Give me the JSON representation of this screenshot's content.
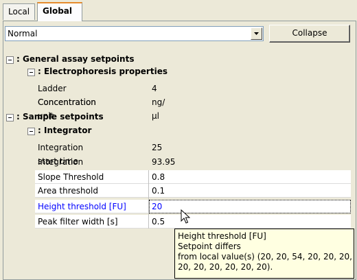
{
  "tabs": [
    {
      "label": "Local"
    },
    {
      "label": "Global"
    }
  ],
  "combo": {
    "value": "Normal"
  },
  "collapse_label": "Collapse",
  "tree": {
    "general": "General assay setpoints",
    "electrophoresis": "Electrophoresis properties",
    "sample": "Sample setpoints",
    "integrator": "Integrator",
    "prefix": ": "
  },
  "props": [
    {
      "name": "Ladder Concentration",
      "value": "4"
    },
    {
      "name": "Concentration unit",
      "value": "ng/µl"
    },
    {
      "name": "Integration start time [s]",
      "value": "25"
    },
    {
      "name": "Integration end time [s]",
      "value": "93.95"
    },
    {
      "name": "Slope Threshold",
      "value": "0.8"
    },
    {
      "name": "Area threshold",
      "value": "0.1"
    },
    {
      "name": "Height threshold [FU]",
      "value": "20"
    },
    {
      "name": "Peak filter width [s]",
      "value": "0.5"
    }
  ],
  "tooltip": {
    "line1": "Height threshold [FU]",
    "line2": "Setpoint differs",
    "line3": "from local value(s) (20, 20, 54, 20, 20, 20,",
    "line4": "20, 20, 20, 20, 20, 20)."
  },
  "colors": {
    "changed": "#0000ff",
    "tab_accent": "#e68b2c"
  }
}
